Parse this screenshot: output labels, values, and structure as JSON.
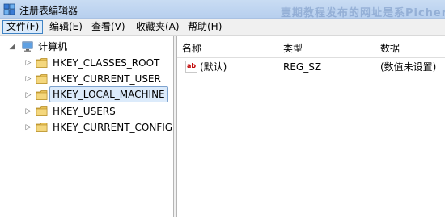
{
  "window": {
    "title": "注册表编辑器",
    "watermark": "壹期教程发布的网址是系Pichen"
  },
  "menu": [
    {
      "label": "文件(F)",
      "active": true
    },
    {
      "label": "编辑(E)"
    },
    {
      "label": "查看(V)"
    },
    {
      "label": "收藏夹(A)"
    },
    {
      "label": "帮助(H)"
    }
  ],
  "tree": {
    "root": {
      "label": "计算机",
      "icon": "computer-icon"
    },
    "items": [
      {
        "label": "HKEY_CLASSES_ROOT",
        "icon": "folder-icon"
      },
      {
        "label": "HKEY_CURRENT_USER",
        "icon": "folder-icon"
      },
      {
        "label": "HKEY_LOCAL_MACHINE",
        "icon": "folder-icon",
        "selected": true
      },
      {
        "label": "HKEY_USERS",
        "icon": "folder-icon"
      },
      {
        "label": "HKEY_CURRENT_CONFIG",
        "icon": "folder-icon"
      }
    ]
  },
  "list": {
    "columns": [
      "名称",
      "类型",
      "数据"
    ],
    "rows": [
      {
        "name": "(默认)",
        "type": "REG_SZ",
        "data": "(数值未设置)",
        "icon": "string-value-icon"
      }
    ]
  },
  "colors": {
    "titlebar": "#c0d6f1",
    "selection": "#dcebfb",
    "selection_border": "#7da2ce",
    "folder": "#e8c25a"
  }
}
